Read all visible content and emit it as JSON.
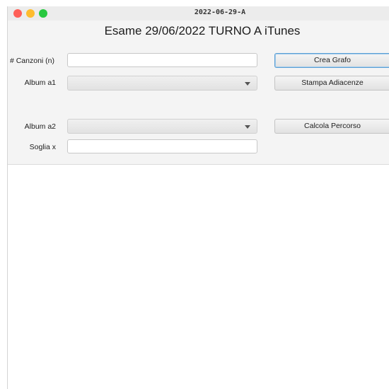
{
  "window": {
    "title": "2022-06-29-A"
  },
  "app": {
    "title": "Esame 29/06/2022 TURNO A iTunes"
  },
  "form": {
    "num_songs_label": "# Canzoni (n)",
    "num_songs_value": "",
    "album1_label": "Album a1",
    "album1_selected": "",
    "album2_label": "Album a2",
    "album2_selected": "",
    "threshold_label": "Soglia x",
    "threshold_value": ""
  },
  "buttons": {
    "create_graph": "Crea Grafo",
    "print_adjacent": "Stampa Adiacenze",
    "compute_path": "Calcola Percorso"
  },
  "output": {
    "text": ""
  }
}
